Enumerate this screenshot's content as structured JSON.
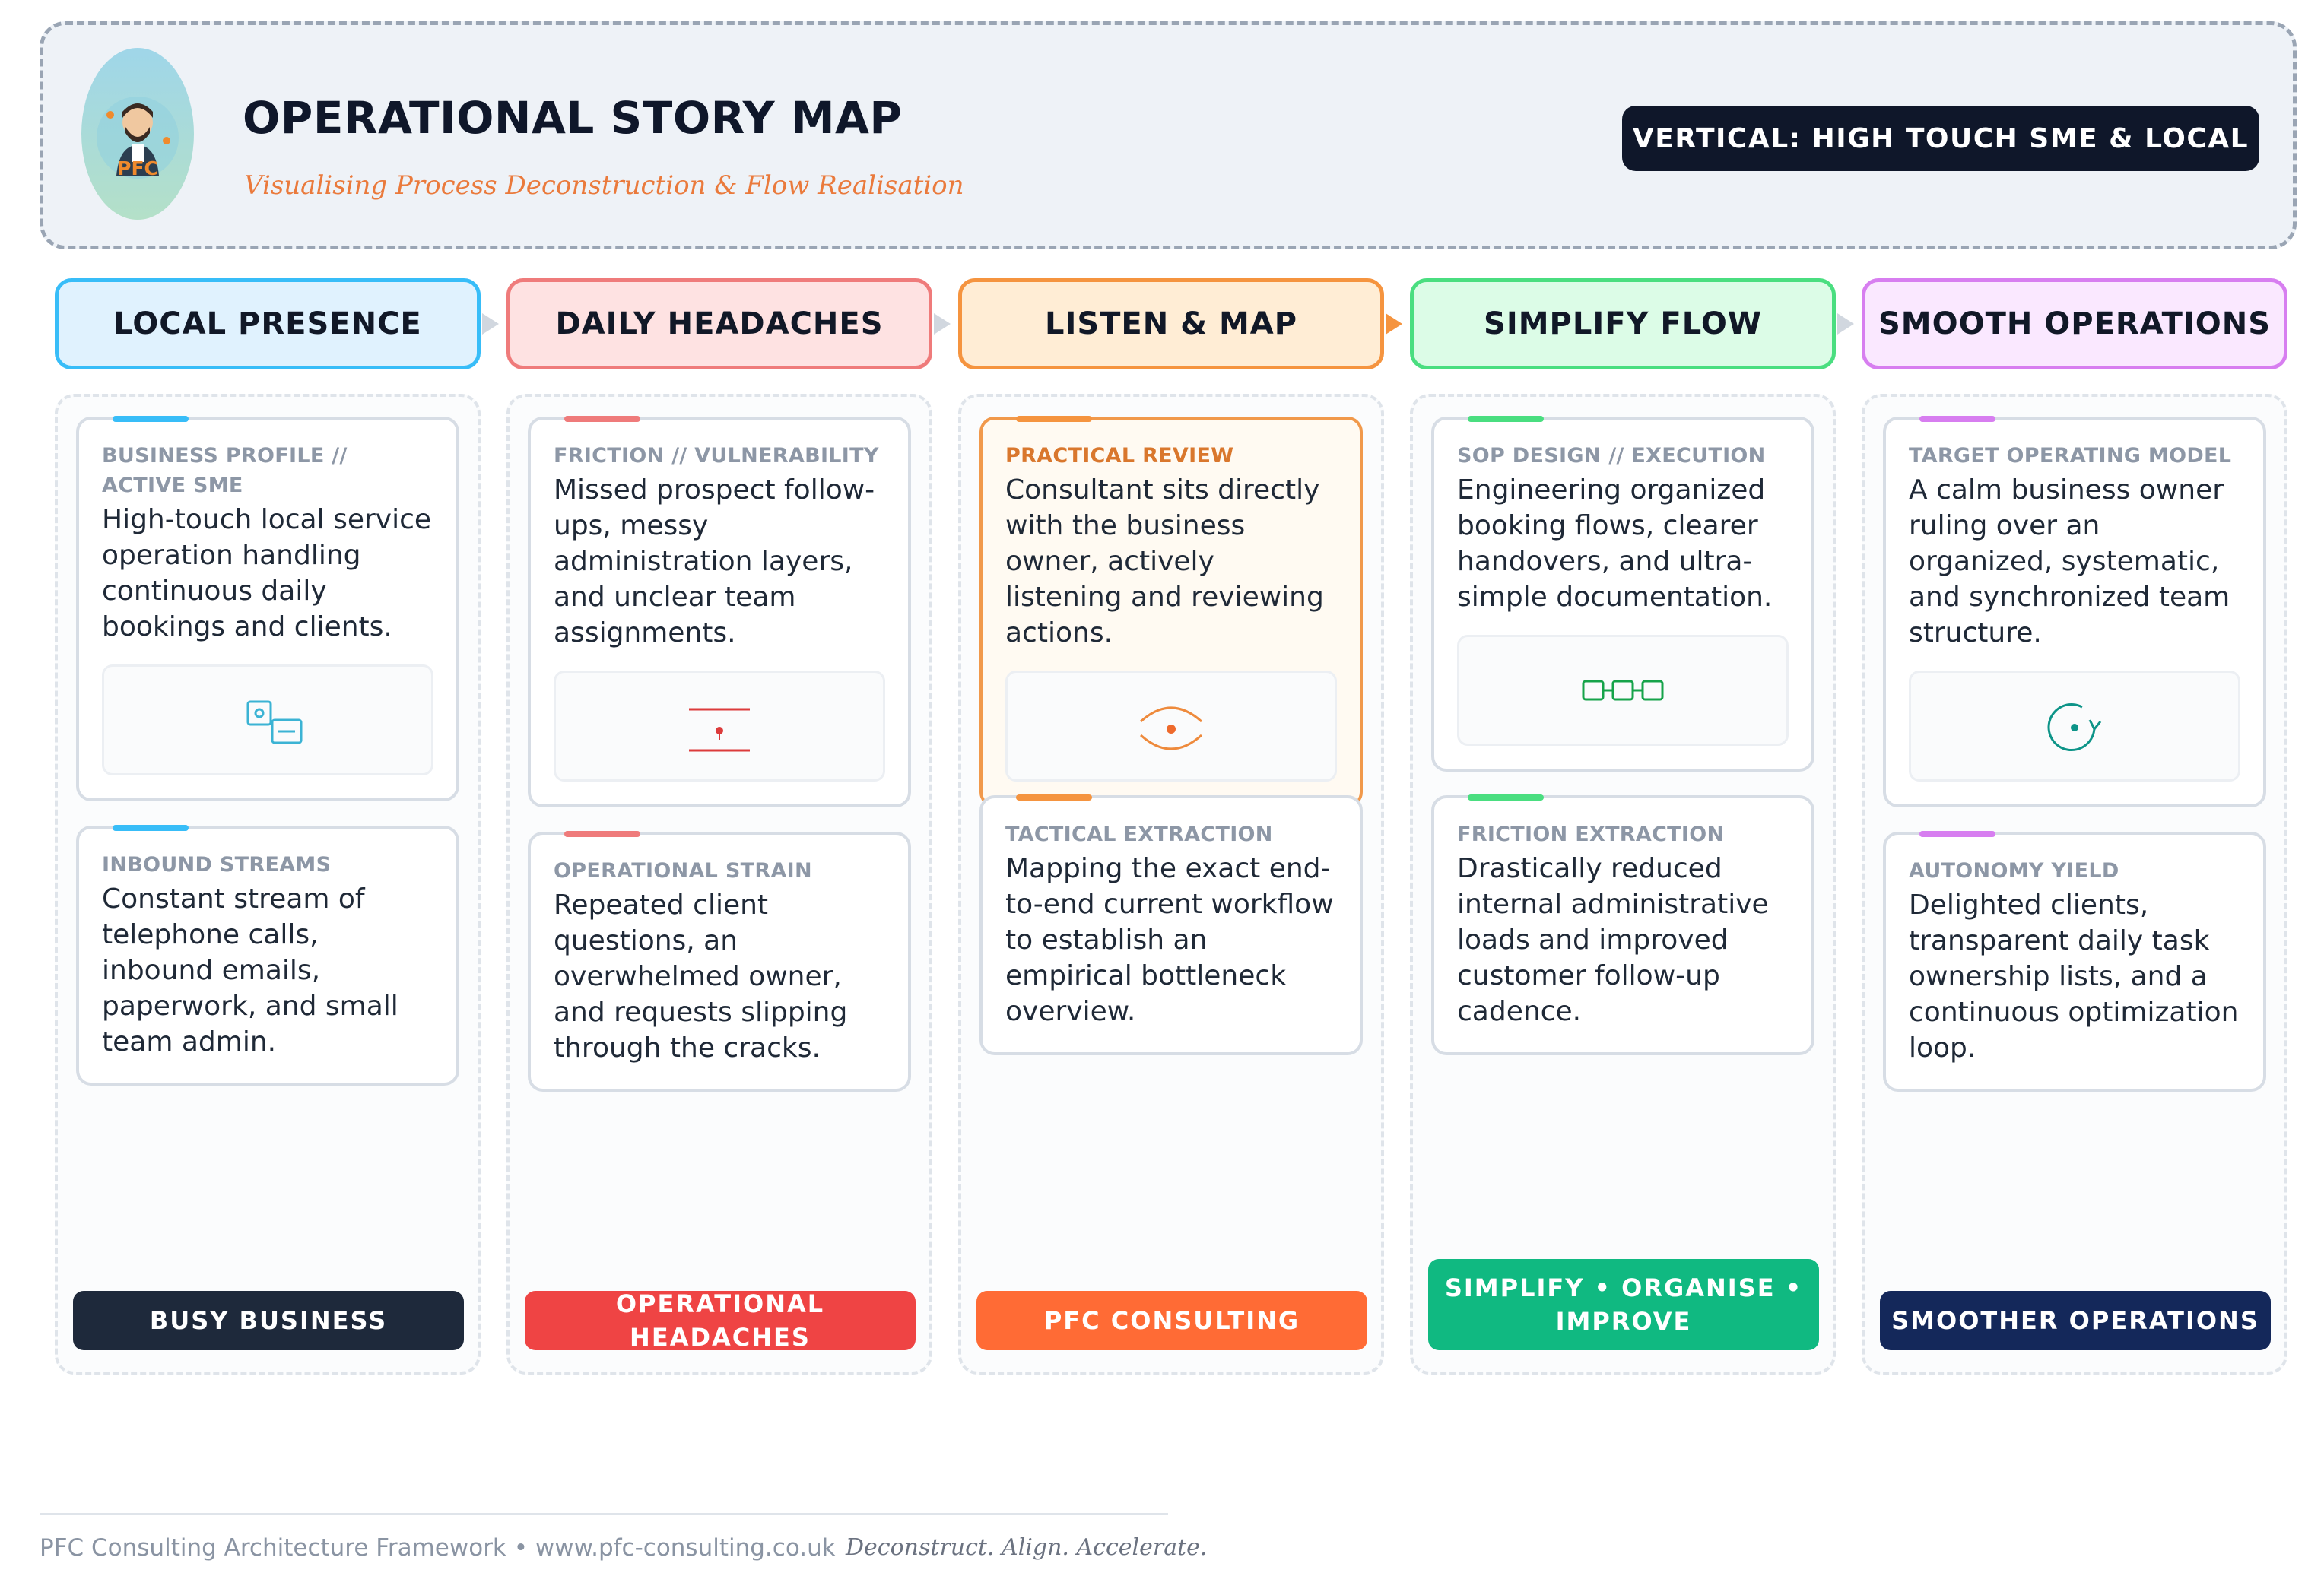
{
  "header": {
    "logo_text": "PFC",
    "title": "OPERATIONAL STORY MAP",
    "subtitle": "Visualising Process Deconstruction & Flow Realisation",
    "vertical_badge": "VERTICAL: HIGH TOUCH SME & LOCAL"
  },
  "colors": {
    "navy": "#0f172a",
    "blue": "#38bdf8",
    "red": "#ef6b6b",
    "orange": "#f5943f",
    "green": "#4ade80",
    "violet": "#d77ef0"
  },
  "stages": [
    {
      "label": "LOCAL PRESENCE",
      "cards": [
        {
          "label": "BUSINESS PROFILE // ACTIVE SME",
          "text": "High-touch local service operation handling continuous daily bookings and clients.",
          "icon": "devices-icon"
        },
        {
          "label": "INBOUND STREAMS",
          "text": "Constant stream of telephone calls, inbound emails, paperwork, and small team admin."
        }
      ],
      "footer": "BUSY BUSINESS"
    },
    {
      "label": "DAILY HEADACHES",
      "cards": [
        {
          "label": "FRICTION // VULNERABILITY",
          "text": "Missed prospect follow-ups, messy administration layers, and unclear team assignments.",
          "icon": "friction-icon"
        },
        {
          "label": "OPERATIONAL STRAIN",
          "text": "Repeated client questions, an overwhelmed owner, and requests slipping through the cracks."
        }
      ],
      "footer": "OPERATIONAL HEADACHES"
    },
    {
      "label": "LISTEN & MAP",
      "cards": [
        {
          "label": "PRACTICAL REVIEW",
          "text": "Consultant sits directly with the business owner, actively listening and reviewing actions.",
          "icon": "eye-icon"
        },
        {
          "label": "TACTICAL EXTRACTION",
          "text": "Mapping the exact end-to-end current workflow to establish an empirical bottleneck overview."
        }
      ],
      "footer": "PFC CONSULTING"
    },
    {
      "label": "SIMPLIFY FLOW",
      "cards": [
        {
          "label": "SOP DESIGN // EXECUTION",
          "text": "Engineering organized booking flows, clearer handovers, and ultra-simple documentation.",
          "icon": "flow-chain-icon"
        },
        {
          "label": "FRICTION EXTRACTION",
          "text": "Drastically reduced internal administrative loads and improved customer follow-up cadence."
        }
      ],
      "footer": "SIMPLIFY • ORGANISE • IMPROVE"
    },
    {
      "label": "SMOOTH OPERATIONS",
      "cards": [
        {
          "label": "TARGET OPERATING MODEL",
          "text": "A calm business owner ruling over an organized, systematic, and synchronized team structure.",
          "icon": "cycle-icon"
        },
        {
          "label": "AUTONOMY YIELD",
          "text": "Delighted clients, transparent daily task ownership lists, and a continuous optimization loop."
        }
      ],
      "footer": "SMOOTHER OPERATIONS"
    }
  ],
  "footer": {
    "left": "PFC Consulting Architecture Framework • www.pfc-consulting.co.uk",
    "right": "Deconstruct. Align. Accelerate."
  }
}
